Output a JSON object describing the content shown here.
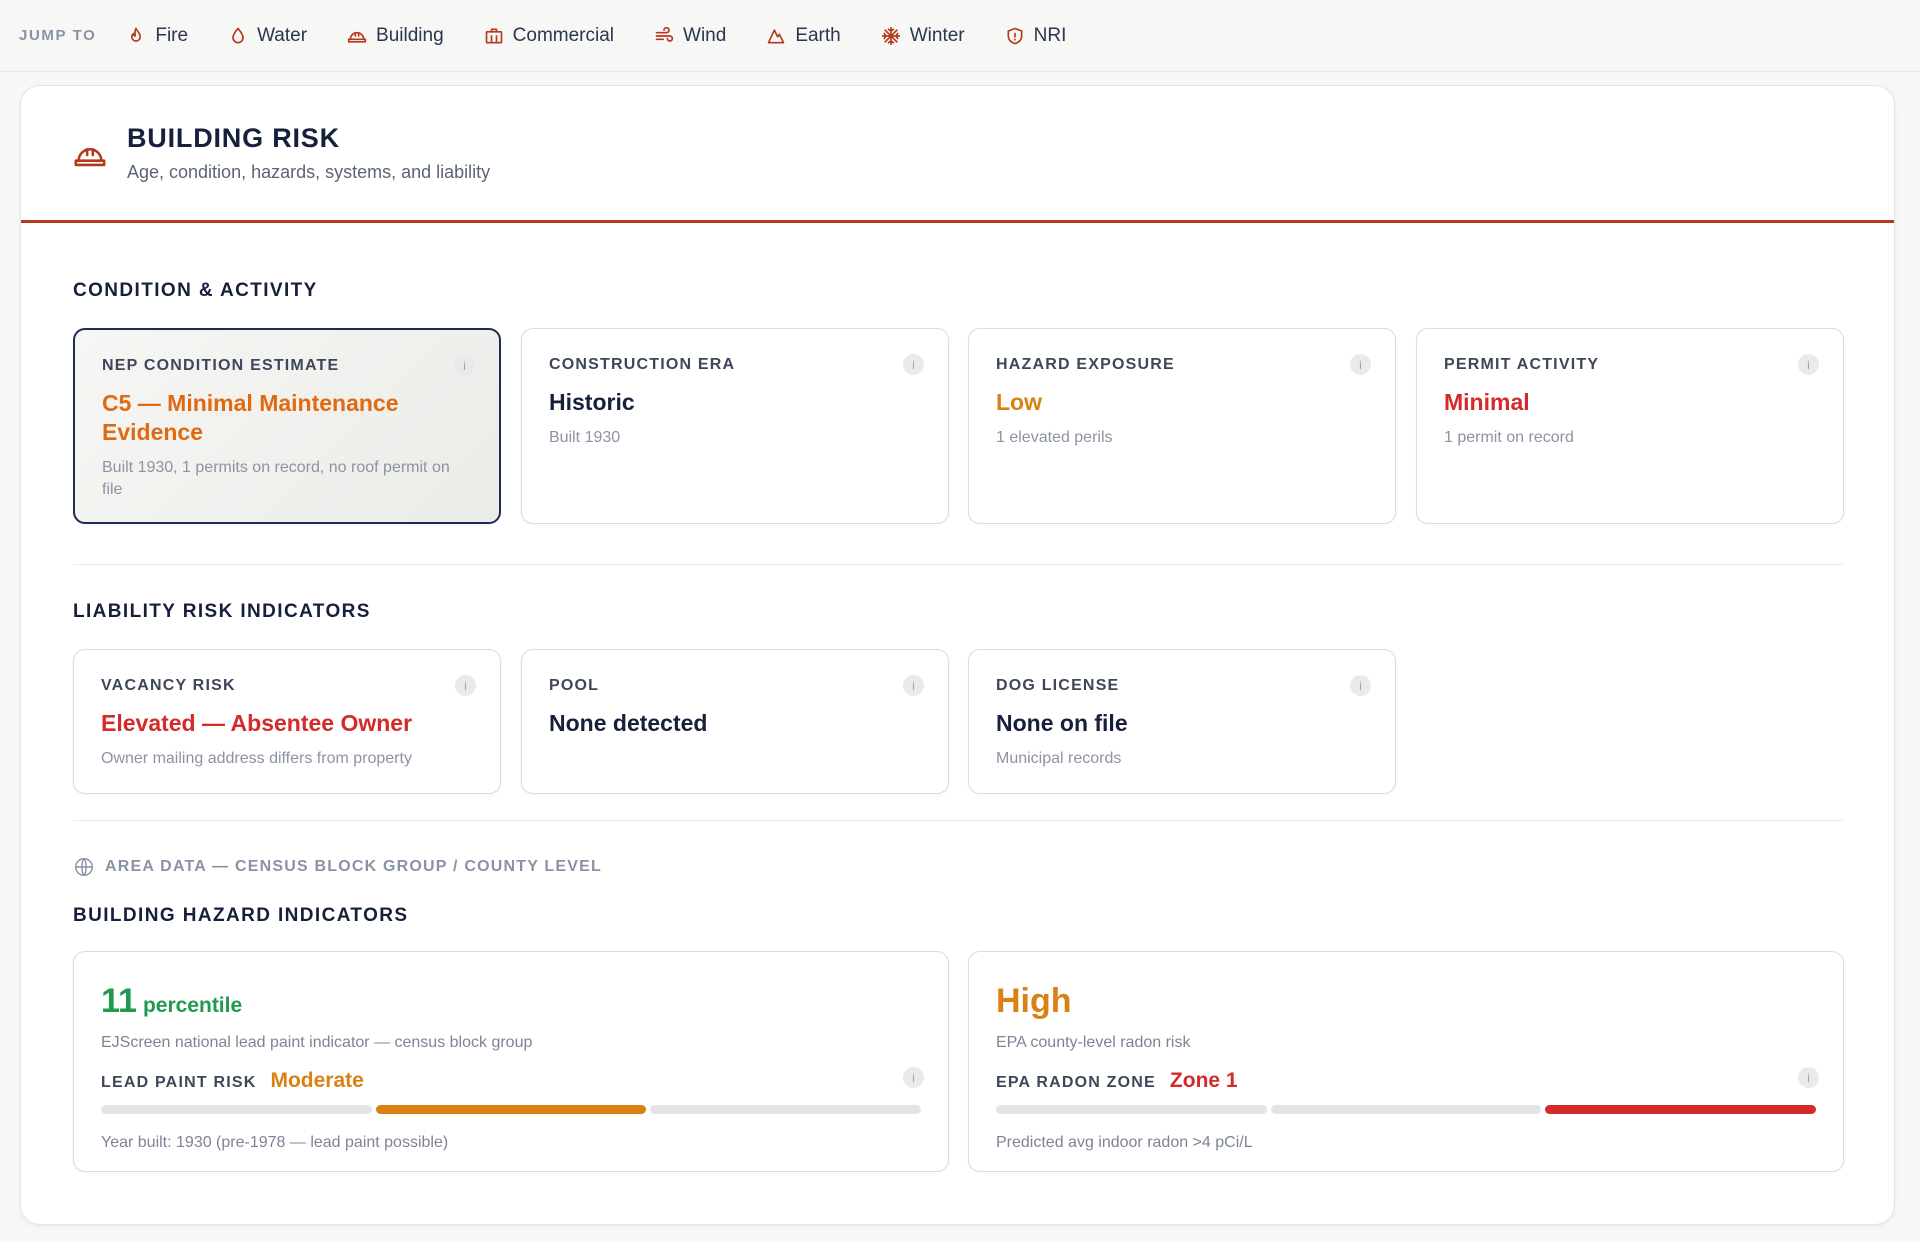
{
  "nav": {
    "label": "JUMP TO",
    "items": [
      {
        "label": "Fire",
        "icon": "flame-icon"
      },
      {
        "label": "Water",
        "icon": "droplet-icon"
      },
      {
        "label": "Building",
        "icon": "hardhat-icon"
      },
      {
        "label": "Commercial",
        "icon": "briefcase-icon"
      },
      {
        "label": "Wind",
        "icon": "wind-icon"
      },
      {
        "label": "Earth",
        "icon": "mountain-icon"
      },
      {
        "label": "Winter",
        "icon": "snowflake-icon"
      },
      {
        "label": "NRI",
        "icon": "shield-icon"
      }
    ]
  },
  "header": {
    "title": "BUILDING RISK",
    "subtitle": "Age, condition, hazards, systems, and liability",
    "icon": "hardhat-icon"
  },
  "condition": {
    "title": "CONDITION & ACTIVITY",
    "tiles": [
      {
        "label": "NEP CONDITION ESTIMATE",
        "value": "C5 — Minimal Maintenance Evidence",
        "note": "Built 1930, 1 permits on record, no roof permit on file",
        "color": "#e06a12"
      },
      {
        "label": "CONSTRUCTION ERA",
        "value": "Historic",
        "note": "Built 1930",
        "color": "#16203c"
      },
      {
        "label": "HAZARD EXPOSURE",
        "value": "Low",
        "note": "1 elevated perils",
        "color": "#d98113"
      },
      {
        "label": "PERMIT ACTIVITY",
        "value": "Minimal",
        "note": "1 permit on record",
        "color": "#d42a2a"
      }
    ]
  },
  "liability": {
    "title": "LIABILITY RISK INDICATORS",
    "tiles": [
      {
        "label": "VACANCY RISK",
        "value": "Elevated — Absentee Owner",
        "note": "Owner mailing address differs from property",
        "color": "#d42a2a"
      },
      {
        "label": "POOL",
        "value": "None detected",
        "note": "",
        "color": "#16203c"
      },
      {
        "label": "DOG LICENSE",
        "value": "None on file",
        "note": "Municipal records",
        "color": "#16203c"
      }
    ]
  },
  "area": {
    "label": "AREA DATA — CENSUS BLOCK GROUP / COUNTY LEVEL",
    "icon": "globe-icon"
  },
  "hazards": {
    "title": "BUILDING HAZARD INDICATORS",
    "lead": {
      "big_value": "11",
      "big_unit": "percentile",
      "description": "EJScreen national lead paint indicator — census block group",
      "label": "LEAD PAINT RISK",
      "level": "Moderate",
      "level_index": 2,
      "segments": 3,
      "footnote": "Year built: 1930 (pre-1978 — lead paint possible)",
      "big_color": "#1f9a4e",
      "level_color": "#d98113"
    },
    "radon": {
      "big_value": "High",
      "big_unit": "",
      "description": "EPA county-level radon risk",
      "label": "EPA RADON ZONE",
      "level": "Zone 1",
      "level_index": 3,
      "segments": 3,
      "footnote": "Predicted avg indoor radon >4 pCi/L",
      "big_color": "#d98113",
      "level_color": "#d42a2a"
    }
  },
  "info_glyph": "i"
}
